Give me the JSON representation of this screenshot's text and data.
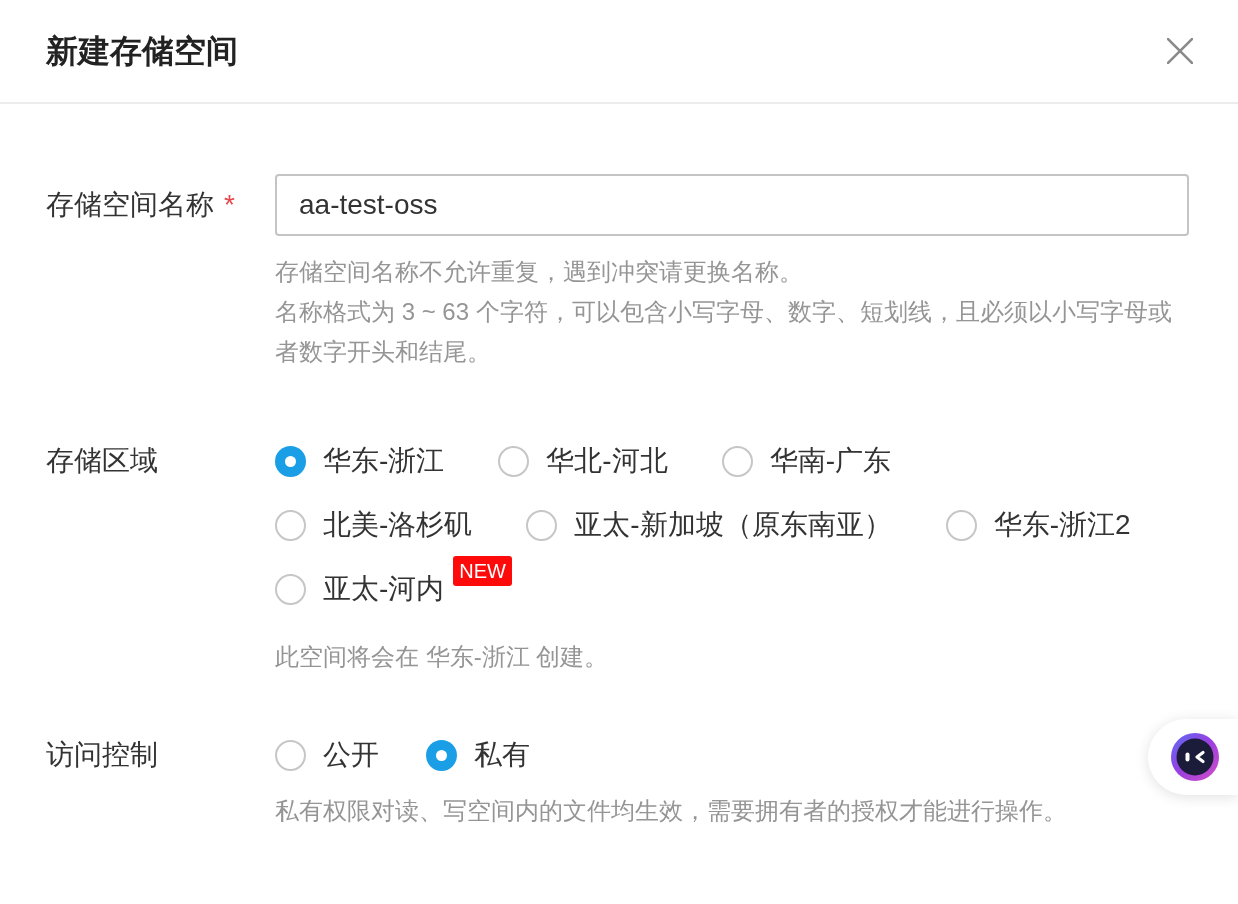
{
  "dialog": {
    "title": "新建存储空间"
  },
  "form": {
    "name_field": {
      "label": "存储空间名称",
      "required_mark": "*",
      "value": "aa-test-oss",
      "hints": [
        "存储空间名称不允许重复，遇到冲突请更换名称。",
        "名称格式为 3 ~ 63 个字符，可以包含小写字母、数字、短划线，且必须以小写字母或者数字开头和结尾。"
      ]
    },
    "region": {
      "label": "存储区域",
      "options": [
        {
          "label": "华东-浙江",
          "selected": true
        },
        {
          "label": "华北-河北",
          "selected": false
        },
        {
          "label": "华南-广东",
          "selected": false
        },
        {
          "label": "北美-洛杉矶",
          "selected": false
        },
        {
          "label": "亚太-新加坡（原东南亚）",
          "selected": false
        },
        {
          "label": "华东-浙江2",
          "selected": false
        },
        {
          "label": "亚太-河内",
          "selected": false,
          "badge": "NEW"
        }
      ],
      "note": "此空间将会在 华东-浙江 创建。"
    },
    "access": {
      "label": "访问控制",
      "options": [
        {
          "label": "公开",
          "selected": false
        },
        {
          "label": "私有",
          "selected": true
        }
      ],
      "note": "私有权限对读、写空间内的文件均生效，需要拥有者的授权才能进行操作。"
    }
  }
}
